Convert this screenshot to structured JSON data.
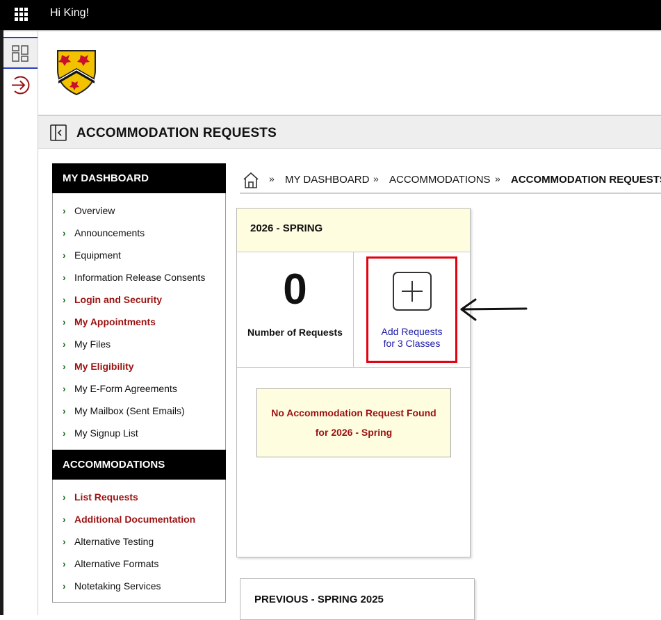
{
  "topbar": {
    "greeting": "Hi King!",
    "apps_icon": "grid-icon"
  },
  "siderail": {
    "dashboard_icon": "dashboard-icon",
    "logout_icon": "logout-icon"
  },
  "page": {
    "title": "ACCOMMODATION REQUESTS",
    "collapse_icon": "sidebar-collapse-icon"
  },
  "breadcrumb": [
    "MY DASHBOARD",
    "ACCOMMODATIONS",
    "ACCOMMODATION REQUESTS"
  ],
  "menu": {
    "dashboard_header": "MY DASHBOARD",
    "dashboard_items": [
      {
        "label": "Overview",
        "highlight": false
      },
      {
        "label": "Announcements",
        "highlight": false
      },
      {
        "label": "Equipment",
        "highlight": false
      },
      {
        "label": "Information Release Consents",
        "highlight": false
      },
      {
        "label": "Login and Security",
        "highlight": true
      },
      {
        "label": "My Appointments",
        "highlight": true
      },
      {
        "label": "My Files",
        "highlight": false
      },
      {
        "label": "My Eligibility",
        "highlight": true
      },
      {
        "label": "My E-Form Agreements",
        "highlight": false
      },
      {
        "label": "My Mailbox (Sent Emails)",
        "highlight": false
      },
      {
        "label": "My Signup List",
        "highlight": false
      }
    ],
    "accommodations_header": "ACCOMMODATIONS",
    "accommodations_items": [
      {
        "label": "List Requests",
        "highlight": true
      },
      {
        "label": "Additional Documentation",
        "highlight": true
      },
      {
        "label": "Alternative Testing",
        "highlight": false
      },
      {
        "label": "Alternative Formats",
        "highlight": false
      },
      {
        "label": "Notetaking Services",
        "highlight": false
      }
    ]
  },
  "term_card": {
    "term": "2026 - SPRING",
    "count": "0",
    "count_label": "Number of Requests",
    "add_line1": "Add Requests",
    "add_line2": "for 3 Classes",
    "empty_line1": "No Accommodation Request Found",
    "empty_line2": "for 2026 - Spring"
  },
  "previous_card": {
    "title": "PREVIOUS - SPRING 2025"
  },
  "colors": {
    "highlight_red": "#9b1111",
    "callout_red": "#e3000f",
    "link_blue": "#1a1aa8",
    "card_yellow": "#fffde0"
  }
}
